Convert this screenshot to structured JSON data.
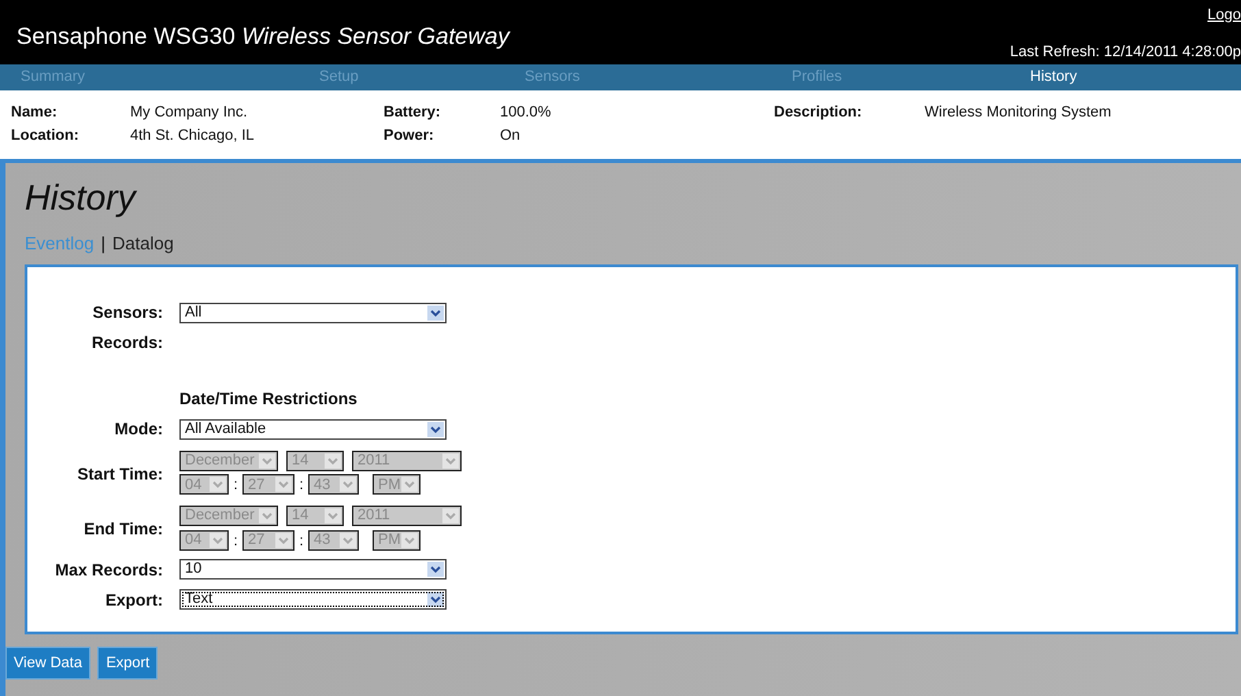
{
  "header": {
    "title": "Sensaphone WSG30",
    "subtitle": "Wireless Sensor Gateway",
    "logout": "Logo",
    "last_refresh": "Last Refresh: 12/14/2011 4:28:00p"
  },
  "nav": [
    {
      "label": "Summary",
      "selected": false
    },
    {
      "label": "Setup",
      "selected": false
    },
    {
      "label": "Sensors",
      "selected": false
    },
    {
      "label": "Profiles",
      "selected": false
    },
    {
      "label": "History",
      "selected": true
    }
  ],
  "info": [
    [
      {
        "label": "Name:",
        "value": "My Company Inc."
      },
      {
        "label": "Location:",
        "value": "4th St. Chicago, IL"
      }
    ],
    [
      {
        "label": "Battery:",
        "value": "100.0%"
      },
      {
        "label": "Power:",
        "value": "On"
      }
    ],
    [
      {
        "label": "Description:",
        "value": "Wireless Monitoring System"
      }
    ]
  ],
  "page_title": "History",
  "subtabs": [
    {
      "label": "Eventlog",
      "selected": true
    },
    {
      "label": "Datalog",
      "selected": false
    }
  ],
  "subtab_separator": "|",
  "form": [
    {
      "kind": "select",
      "label": "Sensors:",
      "value": "All",
      "focused": false
    },
    {
      "kind": "label",
      "label": "Records:"
    },
    {
      "kind": "heading",
      "label": "Date/Time Restrictions"
    },
    {
      "kind": "select",
      "label": "Mode:",
      "value": "All Available",
      "focused": false
    },
    {
      "kind": "datetime",
      "label": "Start Time:",
      "date": [
        {
          "value": "December",
          "disabled": true
        },
        {
          "value": "14",
          "disabled": true
        },
        {
          "value": "2011",
          "disabled": true
        }
      ],
      "time": [
        {
          "value": "04",
          "disabled": true,
          "separator": ":"
        },
        {
          "value": "27",
          "disabled": true,
          "separator": ":"
        },
        {
          "value": "43",
          "disabled": true
        },
        {
          "value": "PM",
          "disabled": true
        }
      ]
    },
    {
      "kind": "datetime",
      "label": "End Time:",
      "date": [
        {
          "value": "December",
          "disabled": true
        },
        {
          "value": "14",
          "disabled": true
        },
        {
          "value": "2011",
          "disabled": true
        }
      ],
      "time": [
        {
          "value": "04",
          "disabled": true,
          "separator": ":"
        },
        {
          "value": "27",
          "disabled": true,
          "separator": ":"
        },
        {
          "value": "43",
          "disabled": true
        },
        {
          "value": "PM",
          "disabled": true
        }
      ]
    },
    {
      "kind": "select",
      "label": "Max Records:",
      "value": "10",
      "focused": false
    },
    {
      "kind": "select",
      "label": "Export:",
      "value": "Text",
      "focused": true
    }
  ],
  "buttons": [
    "View Data",
    "Export"
  ]
}
